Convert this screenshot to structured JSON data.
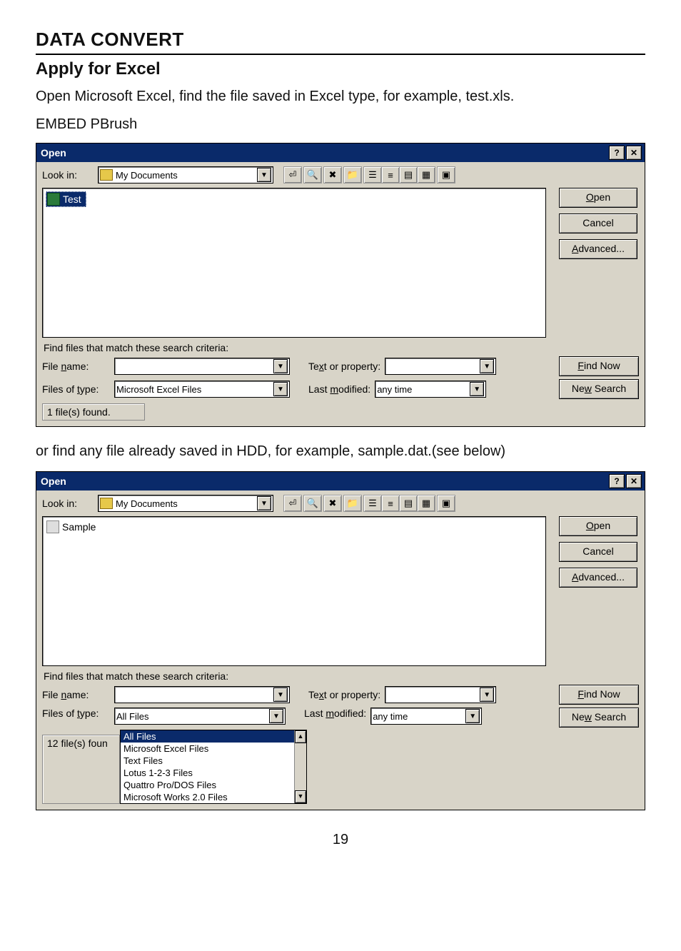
{
  "page_number": "19",
  "heading_main": "DATA CONVERT",
  "heading_sub": "Apply for Excel",
  "intro_paragraph": "Open Microsoft Excel, find the file saved in Excel type, for example, test.xls.",
  "embed_line": "EMBED PBrush",
  "second_paragraph": "or find any file already saved in HDD, for example, sample.dat.(see below)",
  "dialog1": {
    "title": "Open",
    "help_btn": "?",
    "close_btn": "✕",
    "lookin_label": "Look in:",
    "lookin_value": "My Documents",
    "file_selected": "Test",
    "btn_open": "Open",
    "btn_cancel": "Cancel",
    "btn_advanced": "Advanced...",
    "search_caption": "Find files that match these search criteria:",
    "filename_label": "File name:",
    "filename_value": "",
    "text_or_property_label": "Text or property:",
    "text_or_property_value": "",
    "filesoftype_label": "Files of type:",
    "filesoftype_value": "Microsoft Excel Files",
    "lastmodified_label": "Last modified:",
    "lastmodified_value": "any time",
    "btn_findnow": "Find Now",
    "btn_newsearch": "New Search",
    "status": "1 file(s) found."
  },
  "dialog2": {
    "title": "Open",
    "help_btn": "?",
    "close_btn": "✕",
    "lookin_label": "Look in:",
    "lookin_value": "My Documents",
    "file_item": "Sample",
    "btn_open": "Open",
    "btn_cancel": "Cancel",
    "btn_advanced": "Advanced...",
    "search_caption": "Find files that match these search criteria:",
    "filename_label": "File name:",
    "filename_value": "",
    "text_or_property_label": "Text or property:",
    "text_or_property_value": "",
    "filesoftype_label": "Files of type:",
    "filesoftype_value": "All Files",
    "lastmodified_label": "Last modified:",
    "lastmodified_value": "any time",
    "btn_findnow": "Find Now",
    "btn_newsearch": "New Search",
    "status": "12 file(s) foun",
    "dropdown_options": [
      "All Files",
      "Microsoft Excel Files",
      "Text Files",
      "Lotus 1-2-3 Files",
      "Quattro Pro/DOS Files",
      "Microsoft Works 2.0 Files"
    ]
  }
}
